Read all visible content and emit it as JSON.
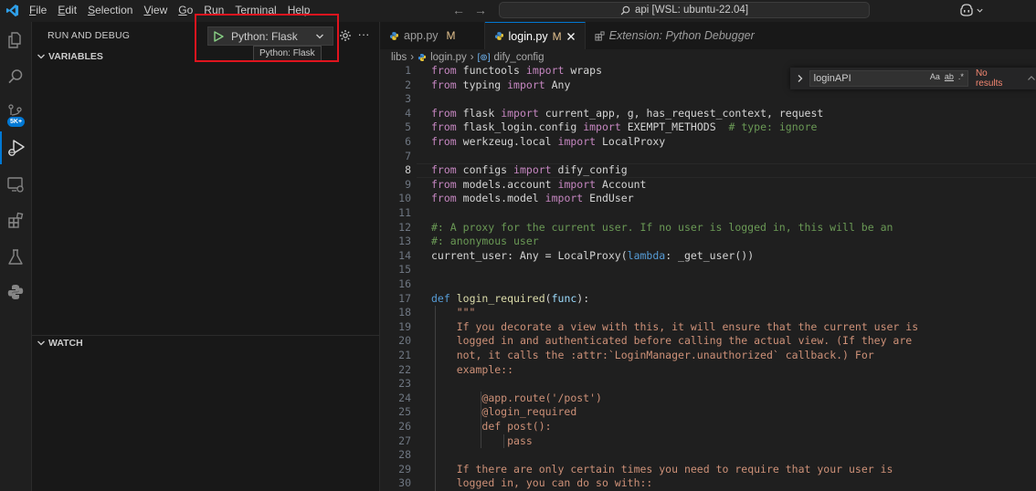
{
  "menu": {
    "items": [
      {
        "label": "File",
        "u": "F",
        "rest": "ile"
      },
      {
        "label": "Edit",
        "u": "E",
        "rest": "dit"
      },
      {
        "label": "Selection",
        "u": "S",
        "rest": "election"
      },
      {
        "label": "View",
        "u": "V",
        "rest": "iew"
      },
      {
        "label": "Go",
        "u": "G",
        "rest": "o"
      },
      {
        "label": "Run",
        "u": "R",
        "rest": "un"
      },
      {
        "label": "Terminal",
        "u": "T",
        "rest": "erminal"
      },
      {
        "label": "Help",
        "u": "H",
        "rest": "elp"
      }
    ]
  },
  "command_center": {
    "text": "api [WSL: ubuntu-22.04]"
  },
  "activity": {
    "accounts_badge": "5K+"
  },
  "sidebar": {
    "title": "RUN AND DEBUG",
    "launch_config": "Python: Flask",
    "tooltip": "Python: Flask",
    "more": "···",
    "sections": {
      "variables": "VARIABLES",
      "watch": "WATCH"
    }
  },
  "tabs": [
    {
      "label": "app.py",
      "status": "M",
      "active": false,
      "preview": false
    },
    {
      "label": "login.py",
      "status": "M",
      "active": true,
      "preview": false
    },
    {
      "label": "Extension: Python Debugger",
      "status": "",
      "active": false,
      "preview": true
    }
  ],
  "breadcrumb": {
    "folder": "libs",
    "file": "login.py",
    "symbol": "dify_config"
  },
  "find": {
    "query": "loginAPI",
    "match_case": "Aa",
    "whole_word": "ab",
    "regex": ".*",
    "result": "No results"
  },
  "colors": {
    "accent": "#0078d4",
    "highlight_box": "#e0141e",
    "keyword": "#c586c0",
    "string": "#ce9178",
    "comment": "#6a9955"
  },
  "code": {
    "current_line": 8,
    "lines": [
      {
        "n": "1",
        "html": "<span class='kw'>from</span> <span class='pl'>functools</span> <span class='kw'>import</span> <span class='pl'>wraps</span>"
      },
      {
        "n": "2",
        "html": "<span class='kw'>from</span> <span class='pl'>typing</span> <span class='kw'>import</span> <span class='pl'>Any</span>"
      },
      {
        "n": "3",
        "html": ""
      },
      {
        "n": "4",
        "html": "<span class='kw'>from</span> <span class='pl'>flask</span> <span class='kw'>import</span> <span class='pl'>current_app, g, has_request_context, request</span>"
      },
      {
        "n": "5",
        "html": "<span class='kw'>from</span> <span class='pl'>flask_login.config</span> <span class='kw'>import</span> <span class='pl'>EXEMPT_METHODS</span>  <span class='cm'># type: ignore</span>"
      },
      {
        "n": "6",
        "html": "<span class='kw'>from</span> <span class='pl'>werkzeug.local</span> <span class='kw'>import</span> <span class='pl'>LocalProxy</span>"
      },
      {
        "n": "7",
        "html": ""
      },
      {
        "n": "8",
        "html": "<span class='kw'>from</span> <span class='pl'>configs</span> <span class='kw'>import</span> <span class='pl'>dify_config</span>"
      },
      {
        "n": "9",
        "html": "<span class='kw'>from</span> <span class='pl'>models.account</span> <span class='kw'>import</span> <span class='pl'>Account</span>"
      },
      {
        "n": "10",
        "html": "<span class='kw'>from</span> <span class='pl'>models.model</span> <span class='kw'>import</span> <span class='pl'>EndUser</span>"
      },
      {
        "n": "11",
        "html": ""
      },
      {
        "n": "12",
        "html": "<span class='cm'>#: A proxy for the current user. If no user is logged in, this will be an</span>"
      },
      {
        "n": "13",
        "html": "<span class='cm'>#: anonymous user</span>"
      },
      {
        "n": "14",
        "html": "<span class='pl'>current_user: Any = LocalProxy(</span><span class='df'>lambda</span><span class='pl'>: _get_user())</span>"
      },
      {
        "n": "15",
        "html": ""
      },
      {
        "n": "16",
        "html": ""
      },
      {
        "n": "17",
        "html": "<span class='df'>def</span> <span class='fn'>login_required</span><span class='pl'>(</span><span class='par'>func</span><span class='pl'>):</span>"
      },
      {
        "n": "18",
        "html": "    <span class='str'>\"\"\"</span>"
      },
      {
        "n": "19",
        "html": "    <span class='str'>If you decorate a view with this, it will ensure that the current user is</span>"
      },
      {
        "n": "20",
        "html": "    <span class='str'>logged in and authenticated before calling the actual view. (If they are</span>"
      },
      {
        "n": "21",
        "html": "    <span class='str'>not, it calls the :attr:`LoginManager.unauthorized` callback.) For</span>"
      },
      {
        "n": "22",
        "html": "    <span class='str'>example::</span>"
      },
      {
        "n": "23",
        "html": ""
      },
      {
        "n": "24",
        "html": "        <span class='str'>@app.route('/post')</span>"
      },
      {
        "n": "25",
        "html": "        <span class='str'>@login_required</span>"
      },
      {
        "n": "26",
        "html": "        <span class='str'>def post():</span>"
      },
      {
        "n": "27",
        "html": "            <span class='str'>pass</span>"
      },
      {
        "n": "28",
        "html": ""
      },
      {
        "n": "29",
        "html": "    <span class='str'>If there are only certain times you need to require that your user is</span>"
      },
      {
        "n": "30",
        "html": "    <span class='str'>logged in, you can do so with::</span>"
      }
    ]
  }
}
